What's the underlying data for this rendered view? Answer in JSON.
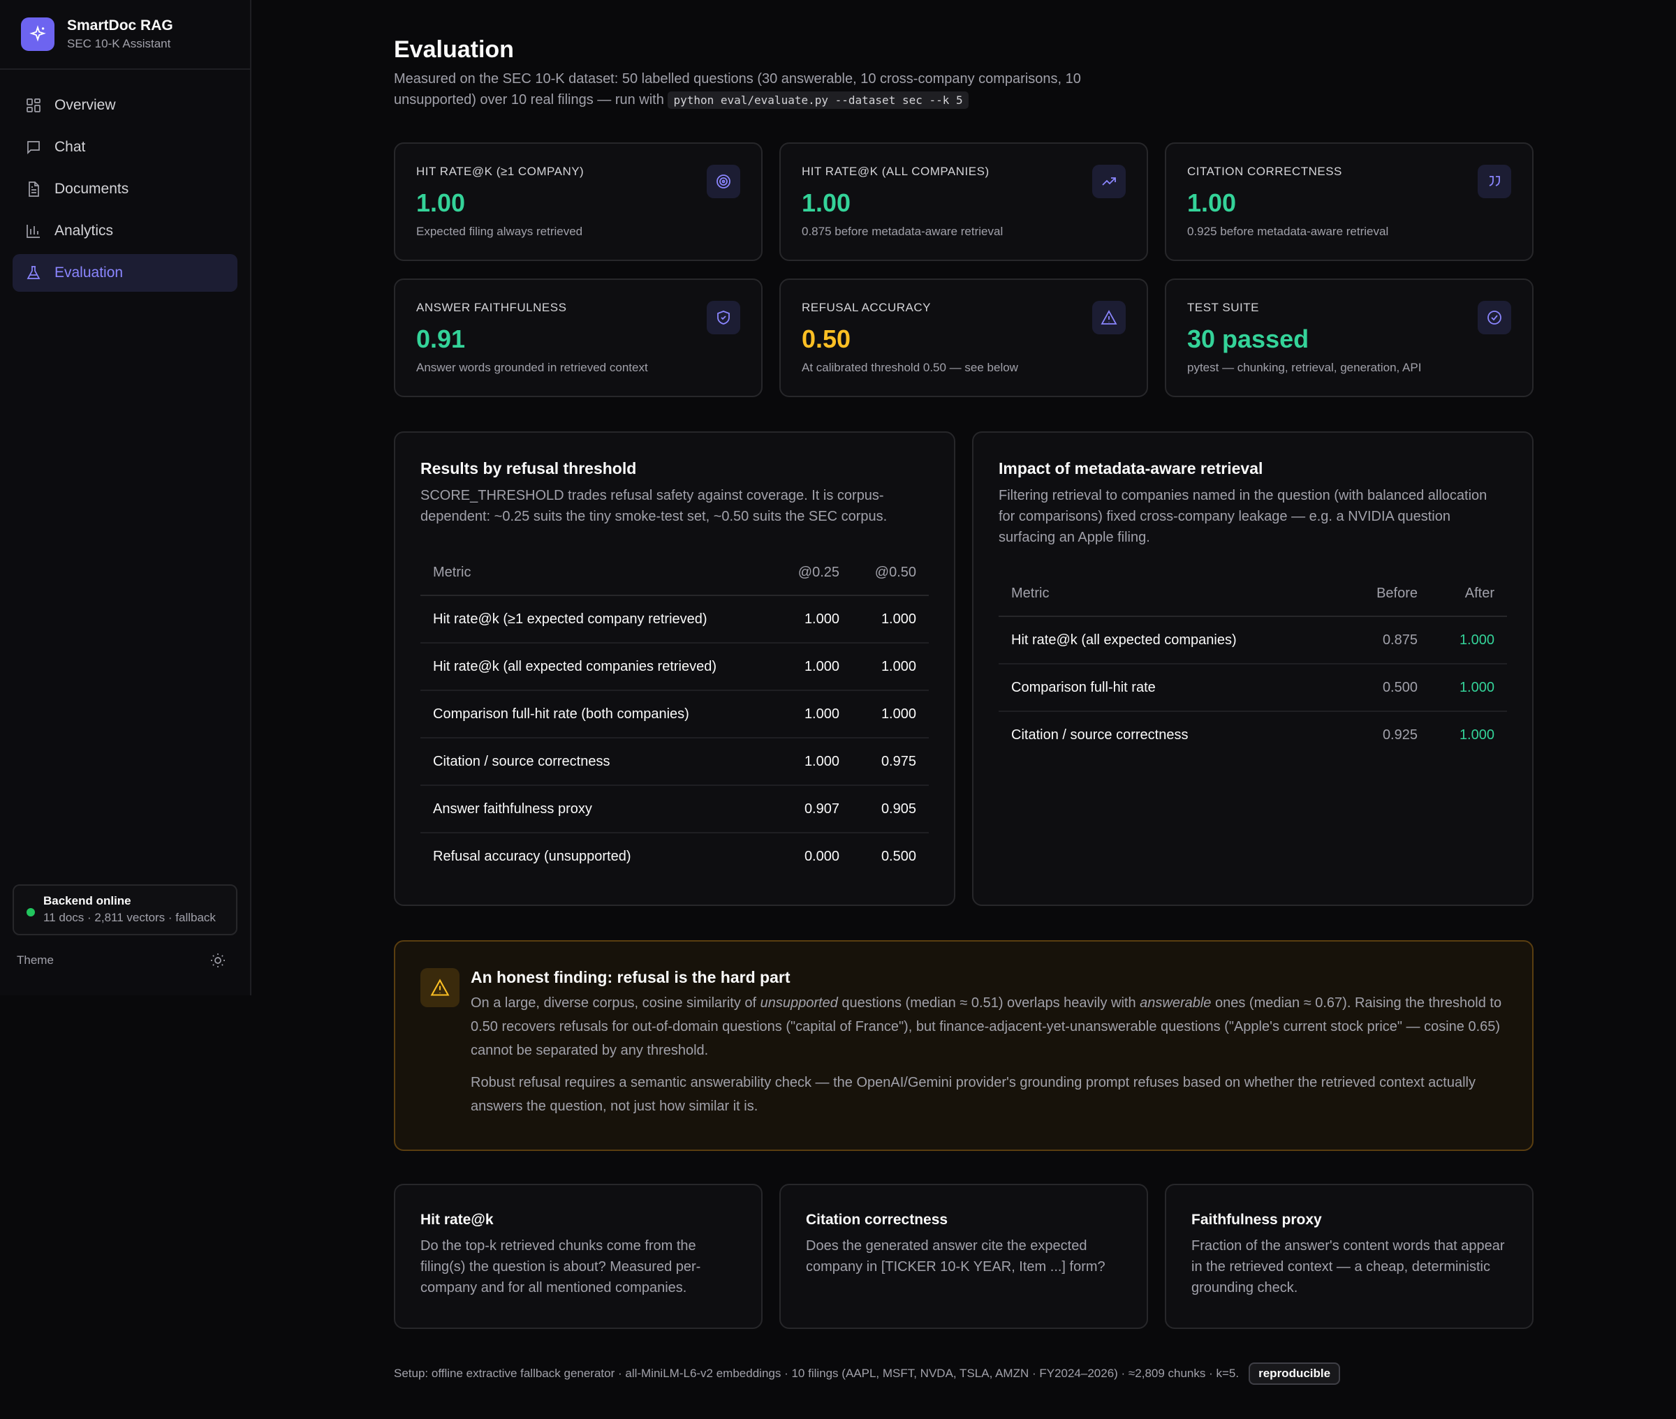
{
  "sidebar": {
    "brand_name": "SmartDoc RAG",
    "brand_sub": "SEC 10-K Assistant",
    "items": [
      {
        "label": "Overview",
        "icon": "grid-icon"
      },
      {
        "label": "Chat",
        "icon": "chat-icon"
      },
      {
        "label": "Documents",
        "icon": "document-icon"
      },
      {
        "label": "Analytics",
        "icon": "bar-chart-icon"
      },
      {
        "label": "Evaluation",
        "icon": "flask-icon",
        "active": true
      }
    ],
    "status_title": "Backend online",
    "status_sub": "11 docs · 2,811 vectors · fallback",
    "theme_label": "Theme"
  },
  "page": {
    "title": "Evaluation",
    "desc": "Measured on the SEC 10-K dataset: 50 labelled questions (30 answerable, 10 cross-company comparisons, 10 unsupported) over 10 real filings — run with",
    "command": "python eval/evaluate.py --dataset sec --k 5"
  },
  "stats": [
    {
      "label": "Hit rate@k (≥1 company)",
      "value": "1.00",
      "sub": "Expected filing always retrieved",
      "icon": "target-icon"
    },
    {
      "label": "Hit rate@k (all companies)",
      "value": "1.00",
      "sub": "0.875 before metadata-aware retrieval",
      "icon": "trending-up-icon"
    },
    {
      "label": "Citation correctness",
      "value": "1.00",
      "sub": "0.925 before metadata-aware retrieval",
      "icon": "quote-icon"
    },
    {
      "label": "Answer faithfulness",
      "value": "0.91",
      "sub": "Answer words grounded in retrieved context",
      "icon": "shield-icon"
    },
    {
      "label": "Refusal accuracy",
      "value": "0.50",
      "sub": "At calibrated threshold 0.50 — see below",
      "icon": "warning-icon"
    },
    {
      "label": "Test suite",
      "value": "30 passed",
      "sub": "pytest — chunking, retrieval, generation, API",
      "icon": "check-circle-icon"
    }
  ],
  "threshold_panel": {
    "title": "Results by refusal threshold",
    "desc": "SCORE_THRESHOLD trades refusal safety against coverage. It is corpus-dependent: ~0.25 suits the tiny smoke-test set, ~0.50 suits the SEC corpus.",
    "headers": [
      "Metric",
      "@0.25",
      "@0.50"
    ],
    "rows": [
      [
        "Hit rate@k (≥1 expected company retrieved)",
        "1.000",
        "1.000"
      ],
      [
        "Hit rate@k (all expected companies retrieved)",
        "1.000",
        "1.000"
      ],
      [
        "Comparison full-hit rate (both companies)",
        "1.000",
        "1.000"
      ],
      [
        "Citation / source correctness",
        "1.000",
        "0.975"
      ],
      [
        "Answer faithfulness proxy",
        "0.907",
        "0.905"
      ],
      [
        "Refusal accuracy (unsupported)",
        "0.000",
        "0.500"
      ]
    ]
  },
  "impact_panel": {
    "title": "Impact of metadata-aware retrieval",
    "desc": "Filtering retrieval to companies named in the question (with balanced allocation for comparisons) fixed cross-company leakage — e.g. a NVIDIA question surfacing an Apple filing.",
    "headers": [
      "Metric",
      "Before",
      "After"
    ],
    "rows": [
      [
        "Hit rate@k (all expected companies)",
        "0.875",
        "1.000"
      ],
      [
        "Comparison full-hit rate",
        "0.500",
        "1.000"
      ],
      [
        "Citation / source correctness",
        "0.925",
        "1.000"
      ]
    ]
  },
  "finding": {
    "title": "An honest finding: refusal is the hard part",
    "p1_a": "On a large, diverse corpus, cosine similarity of ",
    "p1_em1": "unsupported",
    "p1_b": " questions (median ≈ 0.51) overlaps heavily with ",
    "p1_em2": "answerable",
    "p1_c": " ones (median ≈ 0.67). Raising the threshold to 0.50 recovers refusals for out-of-domain questions (\"capital of France\"), but finance-adjacent-yet-unanswerable questions (\"Apple's current stock price\" — cosine 0.65) cannot be separated by any threshold.",
    "p2": "Robust refusal requires a semantic answerability check — the OpenAI/Gemini provider's grounding prompt refuses based on whether the retrieved context actually answers the question, not just how similar it is."
  },
  "definitions": [
    {
      "title": "Hit rate@k",
      "body": "Do the top-k retrieved chunks come from the filing(s) the question is about? Measured per-company and for all mentioned companies."
    },
    {
      "title": "Citation correctness",
      "body": "Does the generated answer cite the expected company in [TICKER 10-K YEAR, Item ...] form?"
    },
    {
      "title": "Faithfulness proxy",
      "body": "Fraction of the answer's content words that appear in the retrieved context — a cheap, deterministic grounding check."
    }
  ],
  "footer": {
    "setup": "Setup: offline extractive fallback generator · all-MiniLM-L6-v2 embeddings · 10 filings (AAPL, MSFT, NVDA, TSLA, AMZN · FY2024–2026) · ≈2,809 chunks · k=5.",
    "badge": "reproducible"
  },
  "colors": {
    "accent": "#8b86ff",
    "good": "#34d399",
    "warn": "#fbbf24",
    "bg": "#09090b"
  }
}
